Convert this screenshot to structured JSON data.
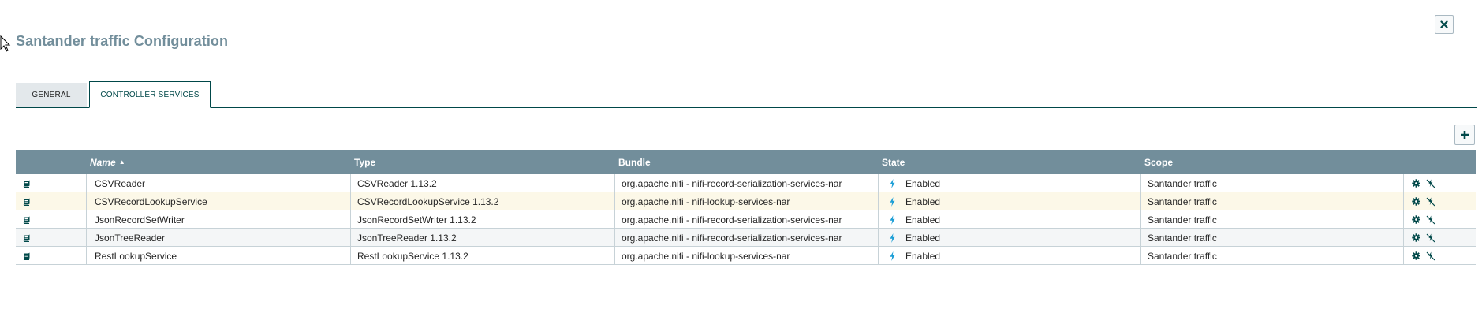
{
  "dialog": {
    "title": "Santander traffic Configuration",
    "close_icon": "close-icon"
  },
  "tabs": [
    {
      "label": "GENERAL",
      "active": false
    },
    {
      "label": "CONTROLLER SERVICES",
      "active": true
    }
  ],
  "toolbar": {
    "add_icon": "plus-icon"
  },
  "table": {
    "columns": {
      "info": "",
      "name": "Name",
      "type": "Type",
      "bundle": "Bundle",
      "state": "State",
      "scope": "Scope",
      "actions": ""
    },
    "sort": {
      "column": "name",
      "direction": "ascending",
      "icon": "sort-up-icon"
    },
    "rows": [
      {
        "name": "CSVReader",
        "type": "CSVReader 1.13.2",
        "bundle": "org.apache.nifi - nifi-record-serialization-services-nar",
        "state": "Enabled",
        "scope": "Santander traffic"
      },
      {
        "name": "CSVRecordLookupService",
        "type": "CSVRecordLookupService 1.13.2",
        "bundle": "org.apache.nifi - nifi-lookup-services-nar",
        "state": "Enabled",
        "scope": "Santander traffic"
      },
      {
        "name": "JsonRecordSetWriter",
        "type": "JsonRecordSetWriter 1.13.2",
        "bundle": "org.apache.nifi - nifi-record-serialization-services-nar",
        "state": "Enabled",
        "scope": "Santander traffic"
      },
      {
        "name": "JsonTreeReader",
        "type": "JsonTreeReader 1.13.2",
        "bundle": "org.apache.nifi - nifi-record-serialization-services-nar",
        "state": "Enabled",
        "scope": "Santander traffic"
      },
      {
        "name": "RestLookupService",
        "type": "RestLookupService 1.13.2",
        "bundle": "org.apache.nifi - nifi-lookup-services-nar",
        "state": "Enabled",
        "scope": "Santander traffic"
      }
    ],
    "row_icons": {
      "info": "usage-book-icon",
      "state": "enabled-bolt-icon",
      "configure": "gear-icon",
      "disable": "disable-icon"
    }
  },
  "colors": {
    "title": "#728e9b",
    "header_bg": "#728e9b",
    "accent": "#004849",
    "highlight_row": "#fcf8e8",
    "alt_row": "#f4f6f7",
    "bolt": "#1b9ed6"
  }
}
